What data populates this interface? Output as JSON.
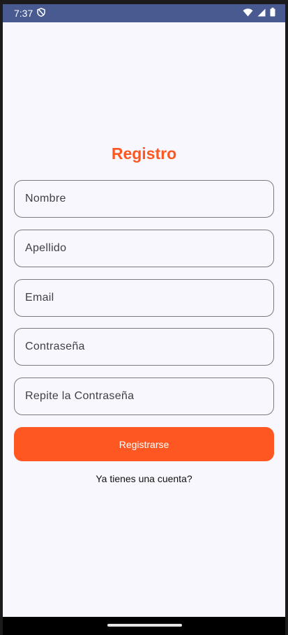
{
  "status_bar": {
    "time": "7:37",
    "icons": [
      "shield-icon",
      "wifi-icon",
      "signal-icon",
      "battery-icon"
    ]
  },
  "form": {
    "title": "Registro",
    "fields": [
      {
        "name": "nombre",
        "placeholder": "Nombre"
      },
      {
        "name": "apellido",
        "placeholder": "Apellido"
      },
      {
        "name": "email",
        "placeholder": "Email"
      },
      {
        "name": "password",
        "placeholder": "Contraseña"
      },
      {
        "name": "repeat-password",
        "placeholder": "Repite la Contraseña"
      }
    ],
    "submit_label": "Registrarse",
    "login_link": "Ya tienes una cuenta?"
  },
  "colors": {
    "accent": "#ff5722",
    "status_bar": "#485a8f",
    "background": "#f8f7fd"
  }
}
